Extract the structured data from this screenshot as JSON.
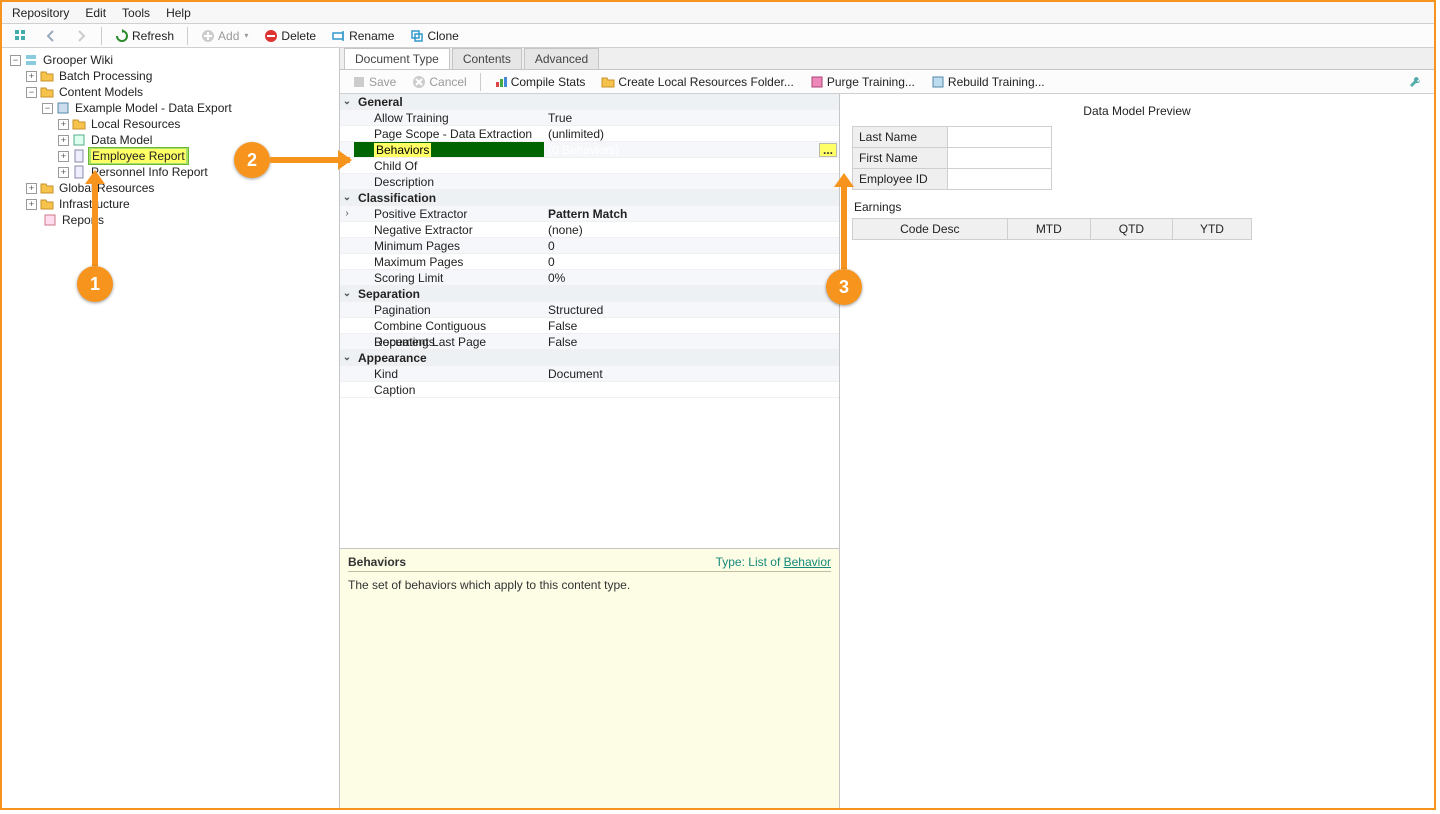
{
  "menu": {
    "repository": "Repository",
    "edit": "Edit",
    "tools": "Tools",
    "help": "Help"
  },
  "toolbar": {
    "refresh": "Refresh",
    "add": "Add",
    "delete": "Delete",
    "rename": "Rename",
    "clone": "Clone"
  },
  "tree": {
    "root": "Grooper Wiki",
    "batch": "Batch Processing",
    "contentModels": "Content Models",
    "example": "Example Model - Data Export",
    "localRes": "Local Resources",
    "dataModel": "Data Model",
    "employee": "Employee Report",
    "personnel": "Personnel Info Report",
    "globalRes": "Global Resources",
    "infra": "Infrastructure",
    "reports": "Reports"
  },
  "tabs": {
    "doc": "Document Type",
    "contents": "Contents",
    "advanced": "Advanced"
  },
  "actions": {
    "save": "Save",
    "cancel": "Cancel",
    "compile": "Compile Stats",
    "createLocal": "Create Local Resources Folder...",
    "purge": "Purge Training...",
    "rebuild": "Rebuild Training..."
  },
  "categories": {
    "general": "General",
    "classification": "Classification",
    "separation": "Separation",
    "appearance": "Appearance"
  },
  "props": {
    "allowTraining": {
      "n": "Allow Training",
      "v": "True"
    },
    "pageScope": {
      "n": "Page Scope - Data Extraction",
      "v": "(unlimited)"
    },
    "behaviors": {
      "n": "Behaviors",
      "v": "(0 Behaviors)"
    },
    "childOf": {
      "n": "Child Of",
      "v": ""
    },
    "description": {
      "n": "Description",
      "v": ""
    },
    "posEx": {
      "n": "Positive Extractor",
      "v": "Pattern Match"
    },
    "negEx": {
      "n": "Negative Extractor",
      "v": "(none)"
    },
    "minP": {
      "n": "Minimum Pages",
      "v": "0"
    },
    "maxP": {
      "n": "Maximum Pages",
      "v": "0"
    },
    "score": {
      "n": "Scoring Limit",
      "v": "0%"
    },
    "pagination": {
      "n": "Pagination",
      "v": "Structured"
    },
    "combine": {
      "n": "Combine Contiguous Documents",
      "v": "False"
    },
    "repeat": {
      "n": "Repeating Last Page",
      "v": "False"
    },
    "kind": {
      "n": "Kind",
      "v": "Document"
    },
    "caption": {
      "n": "Caption",
      "v": ""
    }
  },
  "help": {
    "title": "Behaviors",
    "typePrefix": "Type: ",
    "typeList": "List of ",
    "typeLink": "Behavior",
    "desc": "The set of behaviors which apply to this content type."
  },
  "preview": {
    "title": "Data Model Preview",
    "fields": {
      "lastName": "Last Name",
      "firstName": "First Name",
      "empId": "Employee ID"
    },
    "earnings": "Earnings",
    "cols": {
      "code": "Code Desc",
      "mtd": "MTD",
      "qtd": "QTD",
      "ytd": "YTD"
    }
  },
  "callouts": {
    "c1": "1",
    "c2": "2",
    "c3": "3"
  },
  "ellipsis": "..."
}
